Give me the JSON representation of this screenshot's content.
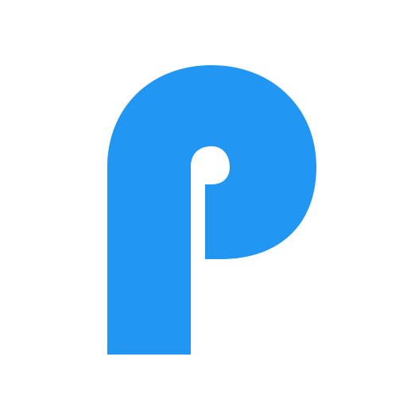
{
  "logo": {
    "glyph": "P",
    "fill_color": "#2196F3",
    "background_color": "#FFFFFF"
  }
}
